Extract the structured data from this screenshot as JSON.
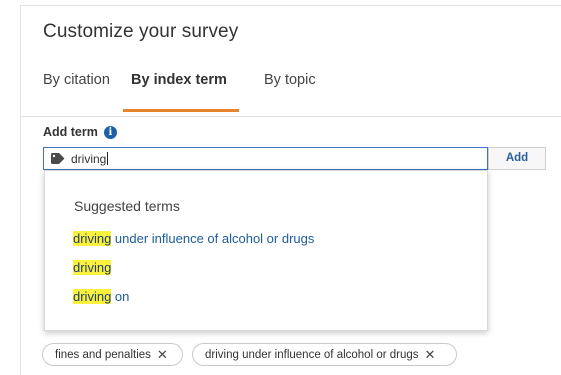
{
  "title": "Customize your survey",
  "tabs": [
    {
      "label": "By citation",
      "active": false
    },
    {
      "label": "By index term",
      "active": true
    },
    {
      "label": "By topic",
      "active": false
    }
  ],
  "add_term": {
    "label": "Add term",
    "info_icon": "i",
    "input_value": "driving",
    "add_button_label": "Add"
  },
  "suggestions": {
    "heading": "Suggested terms",
    "items": [
      {
        "match": "driving",
        "rest": " under influence of alcohol or drugs"
      },
      {
        "match": "driving",
        "rest": ""
      },
      {
        "match": "driving",
        "rest": " on"
      }
    ]
  },
  "selected_terms": [
    {
      "label": "fines and penalties",
      "remove": "✕"
    },
    {
      "label": "driving under influence of alcohol or drugs",
      "remove": "✕"
    }
  ],
  "colors": {
    "accent_underline": "#e8852c",
    "link": "#1d5c9b",
    "highlight": "#fbf03c",
    "info_icon": "#1e5fa8",
    "input_border": "#3b74c4"
  }
}
